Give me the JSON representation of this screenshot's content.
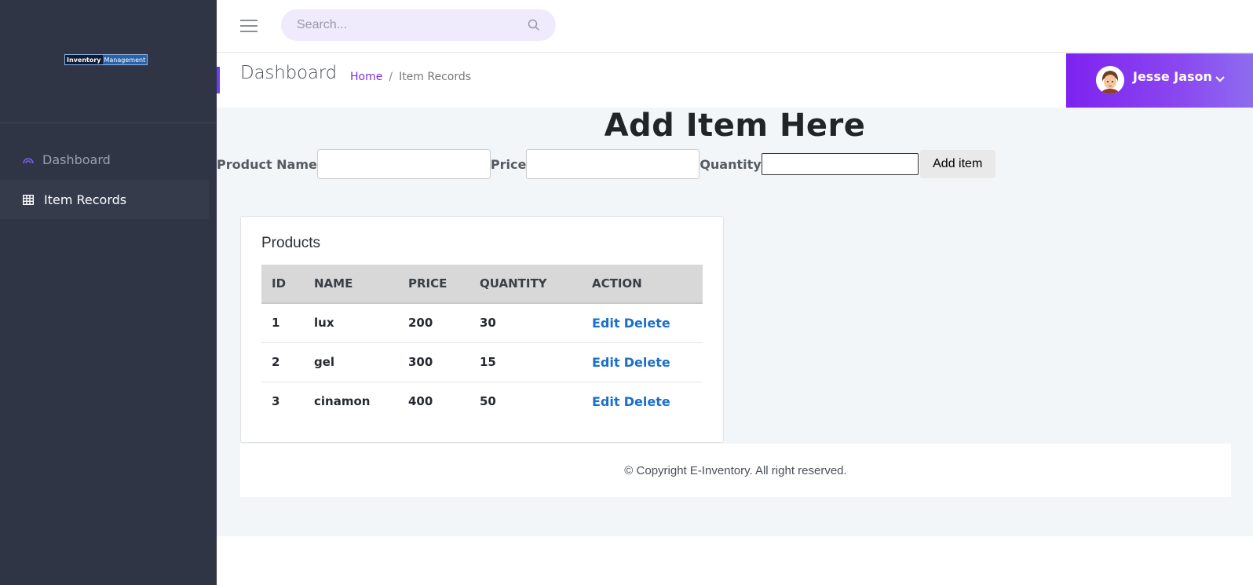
{
  "sidebar": {
    "logo": {
      "part1": "Inventory",
      "part2": "Management"
    },
    "items": [
      {
        "label": "Dashboard",
        "icon": "cloud-icon"
      },
      {
        "label": "Item Records",
        "icon": "table-icon"
      }
    ]
  },
  "topbar": {
    "search": {
      "placeholder": "Search...",
      "icon": "search-icon"
    }
  },
  "header": {
    "title": "Dashboard",
    "breadcrumb": {
      "home": "Home",
      "separator": "/",
      "current": "Item Records"
    }
  },
  "user": {
    "name": "Jesse Jason"
  },
  "form": {
    "title": "Add Item Here",
    "product_name_label": "Product Name",
    "price_label": "Price",
    "quantity_label": "Quantity",
    "product_name_value": "",
    "price_value": "",
    "quantity_value": "",
    "submit_label": "Add item"
  },
  "products": {
    "title": "Products",
    "columns": [
      "ID",
      "NAME",
      "PRICE",
      "QUANTITY",
      "ACTION"
    ],
    "edit_label": "Edit",
    "delete_label": "Delete",
    "rows": [
      {
        "id": "1",
        "name": "lux",
        "price": "200",
        "quantity": "30"
      },
      {
        "id": "2",
        "name": "gel",
        "price": "300",
        "quantity": "15"
      },
      {
        "id": "3",
        "name": "cinamon",
        "price": "400",
        "quantity": "50"
      }
    ]
  },
  "footer": {
    "text": "© Copyright E-Inventory. All right reserved."
  },
  "colors": {
    "sidebar_bg": "#2f3545",
    "accent": "#7e22f0",
    "link": "#1a6fc9",
    "content_bg": "#f2f6f8"
  }
}
